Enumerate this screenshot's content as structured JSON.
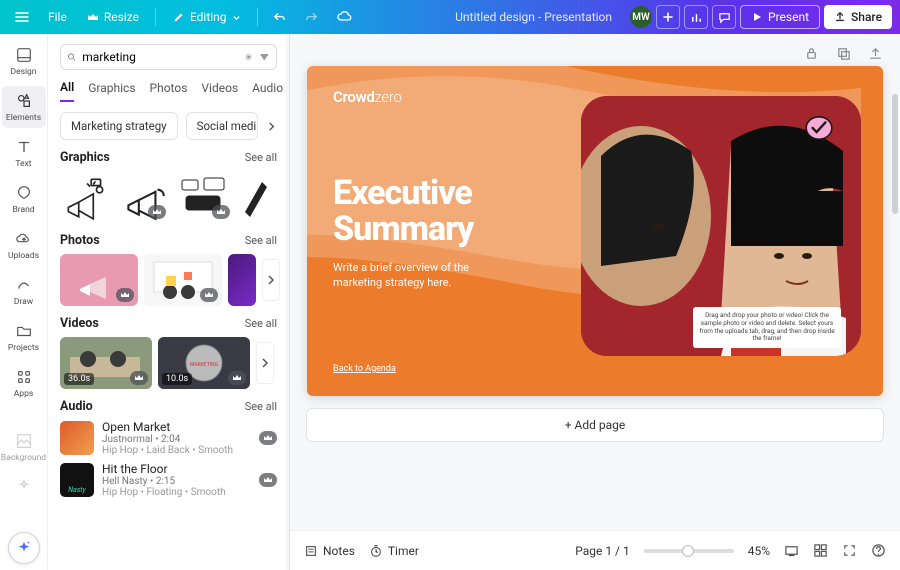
{
  "topbar": {
    "file": "File",
    "resize": "Resize",
    "editing": "Editing",
    "doc_title": "Untitled design - Presentation",
    "avatar_initials": "MW",
    "present": "Present",
    "share": "Share"
  },
  "rail": {
    "items": [
      {
        "label": "Design"
      },
      {
        "label": "Elements"
      },
      {
        "label": "Text"
      },
      {
        "label": "Brand"
      },
      {
        "label": "Uploads"
      },
      {
        "label": "Draw"
      },
      {
        "label": "Projects"
      },
      {
        "label": "Apps"
      },
      {
        "label": "Background"
      }
    ]
  },
  "panel": {
    "search_value": "marketing",
    "tabs": [
      "All",
      "Graphics",
      "Photos",
      "Videos",
      "Audio"
    ],
    "chips": [
      "Marketing strategy",
      "Social media marke"
    ],
    "see_all": "See all",
    "sections": {
      "graphics": "Graphics",
      "photos": "Photos",
      "videos": "Videos",
      "audio": "Audio"
    },
    "video_durations": [
      "36.0s",
      "10.0s"
    ],
    "audio": [
      {
        "title": "Open Market",
        "artist_dur": "Justnormal • 2:04",
        "tags": "Hip Hop • Laid Back • Smooth"
      },
      {
        "title": "Hit the Floor",
        "artist_dur": "Hell Nasty • 2:15",
        "tags": "Hip Hop • Floating • Smooth"
      }
    ]
  },
  "slide": {
    "logo_a": "Crowd",
    "logo_b": "zero",
    "headline_a": "Executive",
    "headline_b": "Summary",
    "sub": "Write a brief overview of the marketing strategy here.",
    "backlink": "Back to Agenda",
    "tip": "Drag and drop your photo or video! Click the sample photo or video and delete. Select yours from the uploads tab, drag, and then drop inside the frame!"
  },
  "canvas": {
    "add_page": "+ Add page"
  },
  "bottombar": {
    "notes": "Notes",
    "timer": "Timer",
    "page": "Page 1 / 1",
    "zoom": "45%"
  }
}
